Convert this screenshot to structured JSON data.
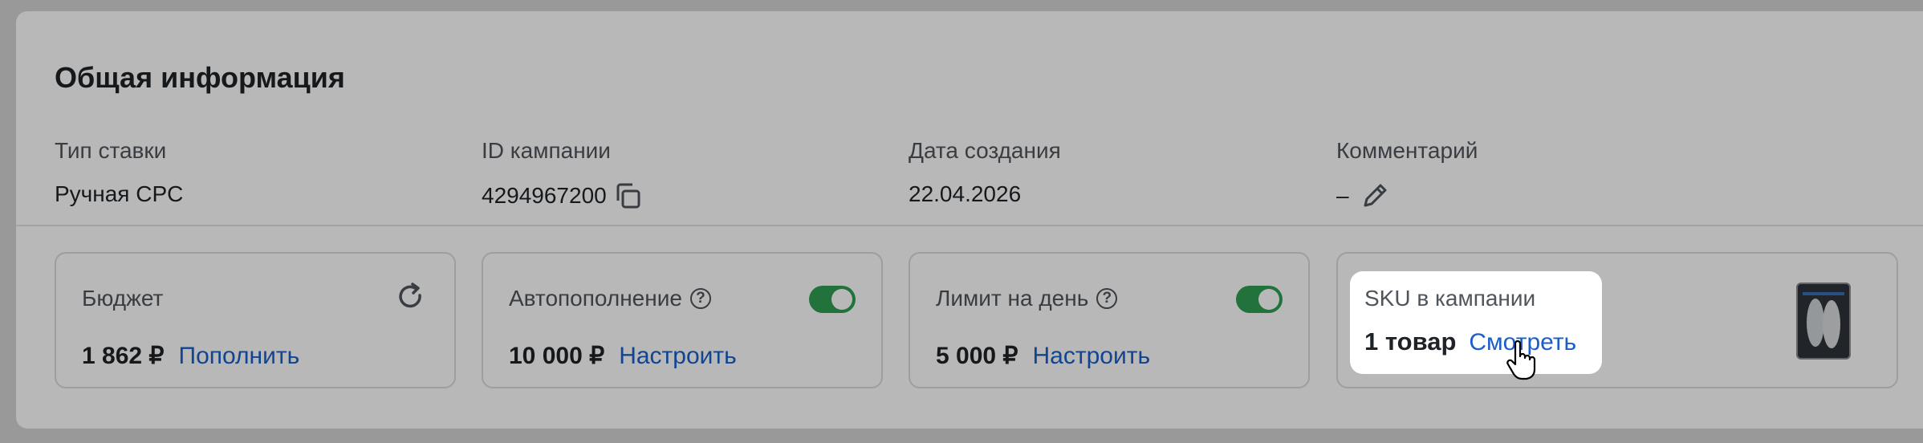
{
  "section": {
    "title": "Общая информация"
  },
  "info_fields": [
    {
      "label": "Тип ставки",
      "value": "Ручная CPC"
    },
    {
      "label": "ID кампании",
      "value": "4294967200"
    },
    {
      "label": "Дата создания",
      "value": "22.04.2026"
    },
    {
      "label": "Комментарий",
      "value": "–"
    }
  ],
  "stats": {
    "budget": {
      "label": "Бюджет",
      "value": "1 862 ₽",
      "action": "Пополнить"
    },
    "autorefill": {
      "label": "Автопополнение",
      "value": "10 000 ₽",
      "action": "Настроить",
      "enabled": true
    },
    "daily_limit": {
      "label": "Лимит на день",
      "value": "5 000 ₽",
      "action": "Настроить",
      "enabled": true
    },
    "sku": {
      "label": "SKU в кампании",
      "value": "1 товар",
      "action": "Смотреть"
    }
  },
  "colors": {
    "accent": "#1a5fc8",
    "toggle_on": "#2e9e52"
  },
  "icons": [
    "copy-icon",
    "pencil-icon",
    "refresh-icon",
    "help-icon",
    "product-thumbnail",
    "hand-cursor-icon"
  ]
}
